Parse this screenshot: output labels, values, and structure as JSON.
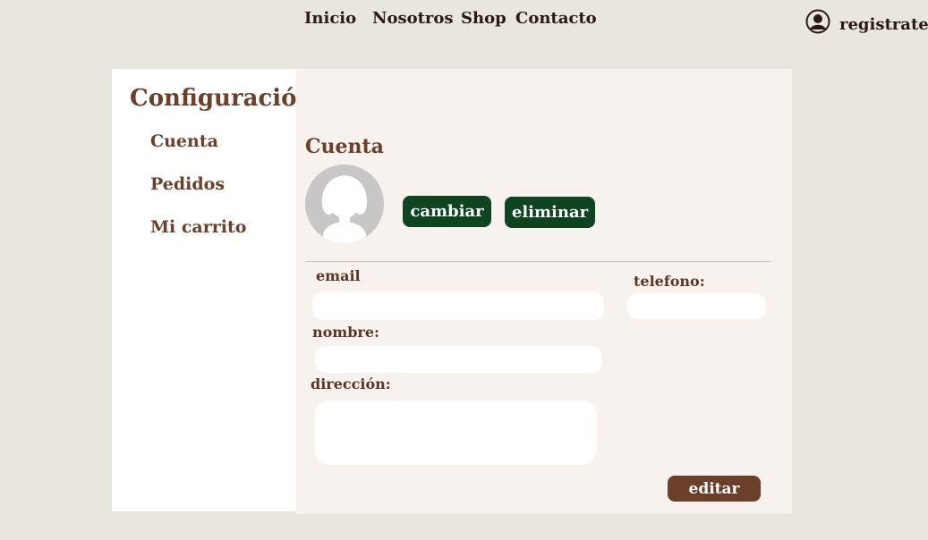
{
  "nav": {
    "items": [
      {
        "label": "Inicio"
      },
      {
        "label": "Nosotros"
      },
      {
        "label": "Shop"
      },
      {
        "label": "Contacto"
      }
    ],
    "account_label": "registrate"
  },
  "sidebar": {
    "title": "Configuración",
    "items": [
      {
        "label": "Cuenta"
      },
      {
        "label": "Pedidos"
      },
      {
        "label": "Mi carrito"
      }
    ]
  },
  "account": {
    "title": "Cuenta",
    "change_label": "cambiar",
    "delete_label": "eliminar",
    "fields": {
      "email_label": "email",
      "email_value": "",
      "phone_label": "telefono:",
      "phone_value": "",
      "name_label": "nombre:",
      "name_value": "",
      "address_label": "dirección:",
      "address_value": ""
    },
    "edit_label": "editar"
  },
  "colors": {
    "brown": "#6b3f2a",
    "green": "#0f4420",
    "background": "#e9e6de"
  }
}
